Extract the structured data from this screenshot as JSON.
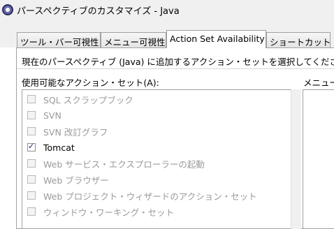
{
  "window": {
    "title": "パースペクティブのカスタマイズ - Java",
    "icon": "eclipse-icon"
  },
  "tabs": [
    {
      "label": "ツール・バー可視性",
      "active": false
    },
    {
      "label": "メニュー可視性",
      "active": false
    },
    {
      "label": "Action Set Availability",
      "active": true
    },
    {
      "label": "ショートカット",
      "active": false
    }
  ],
  "panel": {
    "instruction": "現在のパースペクティブ (Java) に追加するアクション・セットを選択してください",
    "available_label": "使用可能なアクション・セット(A):",
    "menu_label": "メニュー"
  },
  "action_sets": [
    {
      "label": "SQL スクラップブック",
      "checked": false,
      "enabled": false
    },
    {
      "label": "SVN",
      "checked": false,
      "enabled": false
    },
    {
      "label": "SVN 改訂グラフ",
      "checked": false,
      "enabled": false
    },
    {
      "label": "Tomcat",
      "checked": true,
      "enabled": true
    },
    {
      "label": "Web サービス・エクスプローラーの起動",
      "checked": false,
      "enabled": false
    },
    {
      "label": "Web ブラウザー",
      "checked": false,
      "enabled": false
    },
    {
      "label": "Web プロジェクト・ウィザードのアクション・セット",
      "checked": false,
      "enabled": false
    },
    {
      "label": "ウィンドウ・ワーキング・セット",
      "checked": false,
      "enabled": false
    }
  ]
}
